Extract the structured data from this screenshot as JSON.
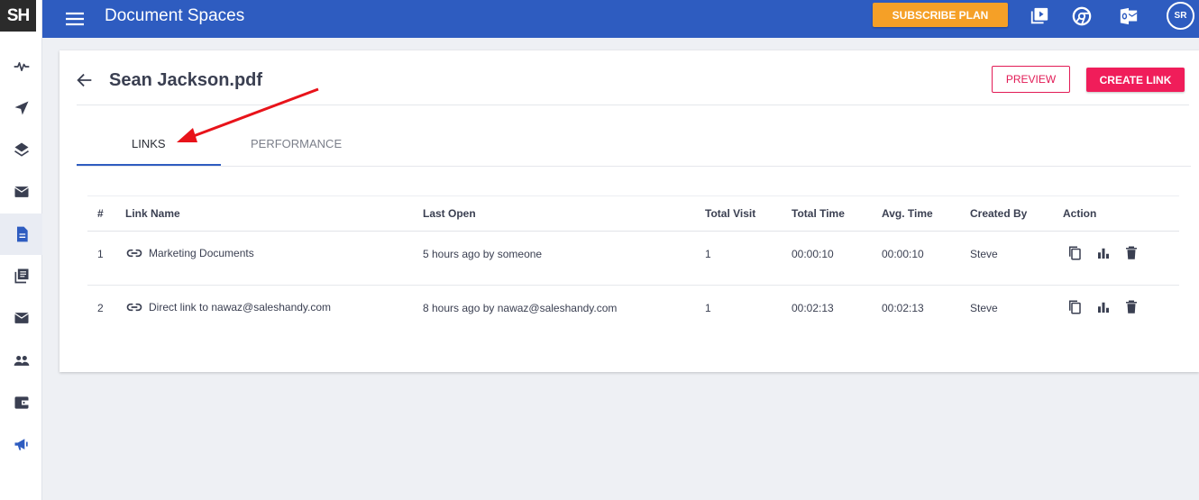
{
  "sidebar": {
    "logo": "SH",
    "items": [
      {
        "icon": "activity-icon"
      },
      {
        "icon": "send-icon"
      },
      {
        "icon": "layers-icon"
      },
      {
        "icon": "mail-icon"
      },
      {
        "icon": "document-icon",
        "active": true
      },
      {
        "icon": "library-icon"
      },
      {
        "icon": "mail-alt-icon"
      },
      {
        "icon": "people-icon"
      },
      {
        "icon": "wallet-icon"
      },
      {
        "icon": "megaphone-icon"
      }
    ]
  },
  "topbar": {
    "title": "Document Spaces",
    "subscribe_label": "SUBSCRIBE PLAN",
    "avatar_initials": "SR",
    "icons": [
      "video-icon",
      "chrome-icon",
      "outlook-icon"
    ]
  },
  "document": {
    "title": "Sean Jackson.pdf",
    "preview_label": "PREVIEW",
    "create_link_label": "CREATE LINK"
  },
  "tabs": [
    {
      "label": "LINKS",
      "active": true
    },
    {
      "label": "PERFORMANCE",
      "active": false
    }
  ],
  "table": {
    "columns": [
      "#",
      "Link Name",
      "Last Open",
      "Total Visit",
      "Total Time",
      "Avg. Time",
      "Created By",
      "Action"
    ],
    "rows": [
      {
        "num": "1",
        "name": "Marketing Documents",
        "last_open": "5 hours ago by someone",
        "total_visit": "1",
        "total_time": "00:00:10",
        "avg_time": "00:00:10",
        "created_by": "Steve"
      },
      {
        "num": "2",
        "name": "Direct link to nawaz@saleshandy.com",
        "last_open": "8 hours ago by nawaz@saleshandy.com",
        "total_visit": "1",
        "total_time": "00:02:13",
        "avg_time": "00:02:13",
        "created_by": "Steve"
      }
    ]
  },
  "colors": {
    "brand_blue": "#2e5cc0",
    "subscribe_orange": "#f5a027",
    "accent_pink": "#f01d5a",
    "annotation_red": "#e8131a"
  }
}
